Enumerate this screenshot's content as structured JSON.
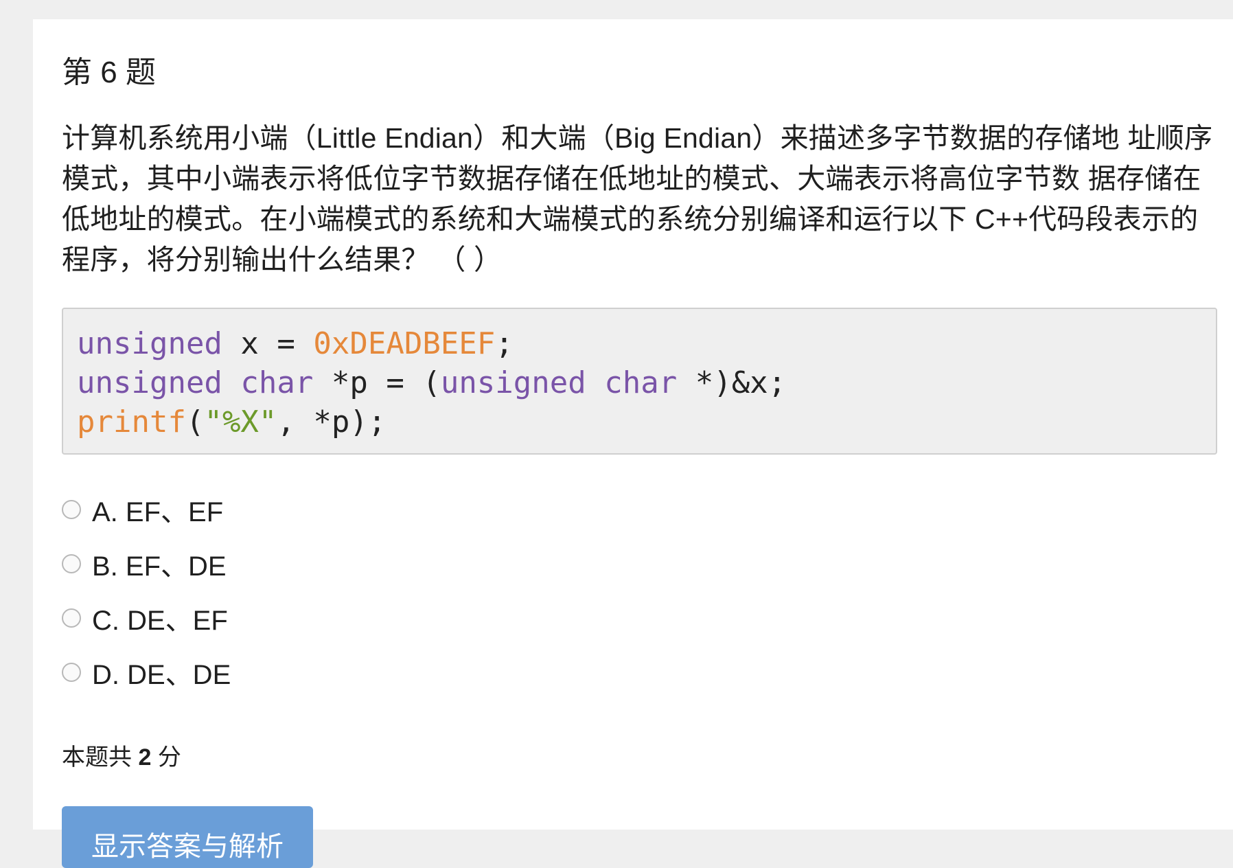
{
  "question": {
    "title": "第 6 题",
    "text": "计算机系统用小端（Little Endian）和大端（Big Endian）来描述多字节数据的存储地 址顺序模式，其中小端表示将低位字节数据存储在低地址的模式、大端表示将高位字节数 据存储在低地址的模式。在小端模式的系统和大端模式的系统分别编译和运行以下 C++代码段表示的程序，将分别输出什么结果？ （ ）"
  },
  "code": {
    "line1": {
      "kw": "unsigned",
      "mid": " x = ",
      "num": "0xDEADBEEF",
      "end": ";"
    },
    "line2": {
      "kw1": "unsigned",
      "kw2": "char",
      "mid1": " *p = (",
      "kw3": "unsigned",
      "kw4": "char",
      "end": " *)&x;"
    },
    "line3": {
      "fn": "printf",
      "open": "(",
      "str": "\"%X\"",
      "end": ", *p);"
    }
  },
  "options": [
    {
      "label": "A. EF、EF"
    },
    {
      "label": "B. EF、DE"
    },
    {
      "label": "C. DE、EF"
    },
    {
      "label": "D. DE、DE"
    }
  ],
  "score": {
    "prefix": "本题共",
    "value": "2",
    "suffix": "分"
  },
  "answer_button": {
    "label": "显示答案与解析"
  },
  "colors": {
    "keyword": "#7a54a8",
    "number": "#e5883a",
    "string": "#6c9a2a",
    "button": "#6a9ed8"
  }
}
